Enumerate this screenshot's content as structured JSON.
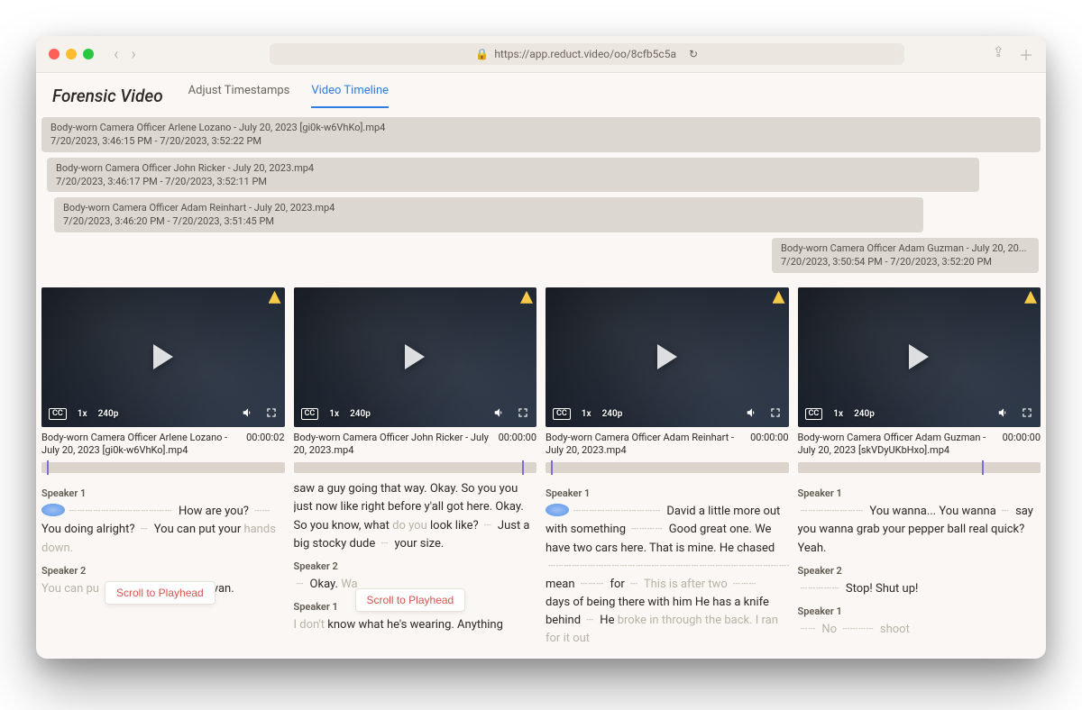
{
  "browser": {
    "url": "https://app.reduct.video/oo/8cfb5c5a"
  },
  "app": {
    "title": "Forensic Video",
    "tabs": {
      "adjust": "Adjust Timestamps",
      "timeline": "Video Timeline"
    }
  },
  "timelineRows": [
    {
      "title": "Body-worn Camera Officer Arlene Lozano - July 20, 2023 [gi0k-w6VhKo].mp4",
      "range": "7/20/2023, 3:46:15 PM - 7/20/2023, 3:52:22 PM"
    },
    {
      "title": "Body-worn Camera Officer John Ricker - July 20, 2023.mp4",
      "range": "7/20/2023, 3:46:17 PM - 7/20/2023, 3:52:11 PM"
    },
    {
      "title": "Body-worn Camera Officer Adam Reinhart - July 20, 2023.mp4",
      "range": "7/20/2023, 3:46:20 PM - 7/20/2023, 3:51:45 PM"
    },
    {
      "title": "Body-worn Camera Officer Adam Guzman - July 20, 20...",
      "range": "7/20/2023, 3:50:54 PM - 7/20/2023, 3:52:20 PM"
    }
  ],
  "controls": {
    "cc": "CC",
    "speed": "1x",
    "res": "240p"
  },
  "videos": [
    {
      "file": "Body-worn Camera Officer Arlene Lozano - July 20, 2023 [gi0k-w6VhKo].mp4",
      "time": "00:00:02",
      "speakers": [
        {
          "name": "Speaker 1",
          "html": "<span class='blob'></span><span class='wave'>┄┄┄┄┄┄┄┄┄┄┄┄┄</span> How are you? <span class='wave'>┄┄</span> You doing alright? <span class='wave'>┄</span> You can put your <span class='faded'>hands down.</span>"
        },
        {
          "name": "Speaker 2",
          "html": "<span class='faded'>You can pu</span><span style='visibility:hidden'>xxxxxxxxxxxx</span>at is my van."
        }
      ],
      "scrollBtn": true,
      "scrollClass": "p1"
    },
    {
      "file": "Body-worn Camera Officer John Ricker - July 20, 2023.mp4",
      "time": "00:00:00",
      "pre": "saw a guy going that way. Okay. So you you just now like right before y'all got here. Okay. So you know, what <span class='faded'>do you</span> look like? <span class='wave'>┄</span> Just a big stocky dude <span class='wave'>┄</span> your size.",
      "speakers": [
        {
          "name": "Speaker 2",
          "html": "<span class='wave'>┄</span> Okay. <span class='faded'>Wa</span>"
        },
        {
          "name": "Speaker 1",
          "html": "<span class='faded'>I don't</span> know what he's wearing. Anything"
        }
      ],
      "scrollBtn": true,
      "scrollClass": "p2"
    },
    {
      "file": "Body-worn Camera Officer Adam Reinhart - July 20, 2023.mp4",
      "time": "00:00:00",
      "speakers": [
        {
          "name": "Speaker 1",
          "html": "<span class='blob'></span><span class='wave'>┄┄┄┄┄┄┄┄┄┄┄</span> David a little more out with something <span class='wave'>┄┄┄┄</span> Good great one. We have two cars here. That is mine. He chased <span class='wave'>┄┄┄┄┄┄┄┄┄┄┄┄┄┄┄┄┄┄┄┄┄┄┄┄┄┄┄┄┄┄┄┄┄</span> mean <span class='wave'>┄┄┄</span> for <span class='wave'>┄</span> <span class='faded'>This is after two</span> <span class='wave'>┄┄┄</span> days of being there with him He has a knife behind <span class='wave'>┄</span> He <span class='faded'>broke in through the back. I ran for it out</span>"
        }
      ]
    },
    {
      "file": "Body-worn Camera Officer Adam Guzman - July 20, 2023 [skVDyUKbHxo].mp4",
      "time": "00:00:00",
      "speakers": [
        {
          "name": "Speaker 1",
          "html": "<span class='wave'>┄┄┄┄┄┄┄┄</span> You wanna... You wanna <span class='wave'>┄</span> say you wanna grab your pepper ball real quick? Yeah."
        },
        {
          "name": "Speaker 2",
          "html": "<span class='wave'>┄┄┄┄┄</span> Stop! Shut up!"
        },
        {
          "name": "Speaker 1",
          "html": "<span class='wave'>┄┄</span> <span class='faded'>No</span> <span class='wave'>┄┄┄┄</span> <span class='faded'>shoot</span>"
        }
      ]
    }
  ],
  "scrollLabel": "Scroll to Playhead"
}
